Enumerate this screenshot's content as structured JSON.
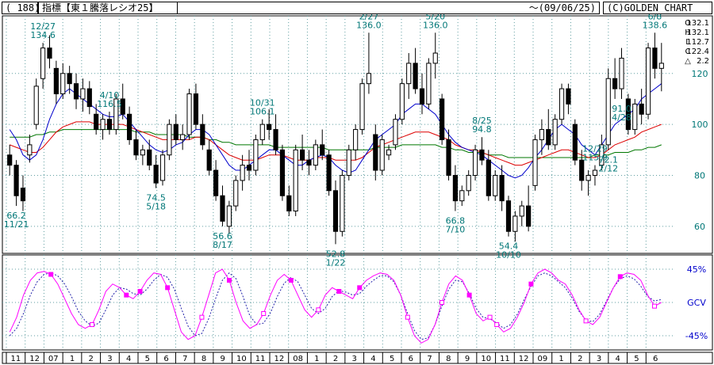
{
  "header": {
    "code": "( 188)",
    "title": "指標【東１騰落レシオ25】",
    "date_range": "～(09/06/25)",
    "brand": "(C)GOLDEN CHART"
  },
  "ohlc": {
    "o_label": "O",
    "o_value": "132.1",
    "h_label": "H",
    "h_value": "132.1",
    "l_label": "L",
    "l_value": "112.7",
    "c_label": "C",
    "c_value": "122.4",
    "d_label": "△",
    "d_value": "2.2"
  },
  "colors": {
    "up_candle": "#ffffff",
    "down_candle": "#000000",
    "ma_short": "#0000cc",
    "ma_mid": "#dd0000",
    "ma_long": "#007700",
    "oscillator": "#ff00ff",
    "oscillator_signal": "#2222aa",
    "annotation": "#007777",
    "grid": "#5f9ea0",
    "oscillator_axis": "#0000cc"
  },
  "chart_data": [
    {
      "type": "candlestick",
      "title": "指標【東１騰落レシオ25】",
      "x_range": [
        "2006-11",
        "2009-06"
      ],
      "ylim": [
        50,
        142
      ],
      "yticks": [
        60,
        80,
        100,
        120
      ],
      "grid": true,
      "legend": "none",
      "x_ticks": [
        "11",
        "12",
        "07",
        "1",
        "2",
        "3",
        "4",
        "5",
        "6",
        "7",
        "8",
        "9",
        "10",
        "11",
        "12",
        "08",
        "1",
        "2",
        "3",
        "4",
        "5",
        "6",
        "7",
        "8",
        "9",
        "10",
        "11",
        "12",
        "09",
        "1",
        "2",
        "3",
        "4",
        "5",
        "6"
      ],
      "annotations": [
        {
          "date": "11/21",
          "value": "66.2",
          "kind": "low"
        },
        {
          "date": "12/27",
          "value": "134.6",
          "kind": "high"
        },
        {
          "date": "4/10",
          "value": "116.5",
          "kind": "high"
        },
        {
          "date": "5/18",
          "value": "74.5",
          "kind": "low"
        },
        {
          "date": "8/17",
          "value": "56.6",
          "kind": "low"
        },
        {
          "date": "10/31",
          "value": "106.1",
          "kind": "high"
        },
        {
          "date": "1/22",
          "value": "52.8",
          "kind": "low"
        },
        {
          "date": "2/27",
          "value": "136.0",
          "kind": "high"
        },
        {
          "date": "5/20",
          "value": "136.0",
          "kind": "high"
        },
        {
          "date": "7/10",
          "value": "66.8",
          "kind": "low"
        },
        {
          "date": "8/25",
          "value": "94.8",
          "kind": "high"
        },
        {
          "date": "10/10",
          "value": "54.4",
          "kind": "low"
        },
        {
          "date": "12/29",
          "value": "115.9",
          "kind": "high"
        },
        {
          "date": "2/12",
          "value": "72.1",
          "kind": "low"
        },
        {
          "date": "4/28",
          "value": "91.0",
          "kind": "low"
        },
        {
          "date": "6/8",
          "value": "138.6",
          "kind": "high"
        }
      ],
      "candles": [
        {
          "o": 88,
          "h": 92,
          "l": 80,
          "c": 84
        },
        {
          "o": 84,
          "h": 86,
          "l": 68,
          "c": 72
        },
        {
          "o": 75,
          "h": 80,
          "l": 66,
          "c": 70
        },
        {
          "o": 88,
          "h": 96,
          "l": 85,
          "c": 92
        },
        {
          "o": 100,
          "h": 118,
          "l": 98,
          "c": 115
        },
        {
          "o": 118,
          "h": 132,
          "l": 114,
          "c": 130
        },
        {
          "o": 130,
          "h": 135,
          "l": 122,
          "c": 126
        },
        {
          "o": 122,
          "h": 125,
          "l": 108,
          "c": 112
        },
        {
          "o": 112,
          "h": 124,
          "l": 110,
          "c": 120
        },
        {
          "o": 120,
          "h": 123,
          "l": 112,
          "c": 116
        },
        {
          "o": 116,
          "h": 120,
          "l": 106,
          "c": 110
        },
        {
          "o": 110,
          "h": 118,
          "l": 105,
          "c": 114
        },
        {
          "o": 114,
          "h": 117,
          "l": 104,
          "c": 107
        },
        {
          "o": 104,
          "h": 108,
          "l": 96,
          "c": 98
        },
        {
          "o": 98,
          "h": 104,
          "l": 94,
          "c": 102
        },
        {
          "o": 102,
          "h": 105,
          "l": 96,
          "c": 98
        },
        {
          "o": 98,
          "h": 112,
          "l": 96,
          "c": 110
        },
        {
          "o": 110,
          "h": 116,
          "l": 102,
          "c": 104
        },
        {
          "o": 104,
          "h": 107,
          "l": 92,
          "c": 94
        },
        {
          "o": 94,
          "h": 98,
          "l": 86,
          "c": 88
        },
        {
          "o": 88,
          "h": 92,
          "l": 84,
          "c": 90
        },
        {
          "o": 90,
          "h": 94,
          "l": 82,
          "c": 84
        },
        {
          "o": 84,
          "h": 88,
          "l": 75,
          "c": 77
        },
        {
          "o": 78,
          "h": 90,
          "l": 76,
          "c": 88
        },
        {
          "o": 88,
          "h": 102,
          "l": 86,
          "c": 100
        },
        {
          "o": 100,
          "h": 104,
          "l": 92,
          "c": 94
        },
        {
          "o": 94,
          "h": 100,
          "l": 90,
          "c": 96
        },
        {
          "o": 96,
          "h": 114,
          "l": 94,
          "c": 112
        },
        {
          "o": 112,
          "h": 116,
          "l": 98,
          "c": 100
        },
        {
          "o": 100,
          "h": 104,
          "l": 90,
          "c": 92
        },
        {
          "o": 90,
          "h": 94,
          "l": 80,
          "c": 82
        },
        {
          "o": 82,
          "h": 86,
          "l": 70,
          "c": 72
        },
        {
          "o": 72,
          "h": 76,
          "l": 60,
          "c": 62
        },
        {
          "o": 60,
          "h": 70,
          "l": 57,
          "c": 68
        },
        {
          "o": 68,
          "h": 80,
          "l": 66,
          "c": 78
        },
        {
          "o": 78,
          "h": 88,
          "l": 74,
          "c": 84
        },
        {
          "o": 84,
          "h": 90,
          "l": 78,
          "c": 82
        },
        {
          "o": 82,
          "h": 96,
          "l": 80,
          "c": 94
        },
        {
          "o": 94,
          "h": 102,
          "l": 92,
          "c": 100
        },
        {
          "o": 100,
          "h": 106,
          "l": 94,
          "c": 98
        },
        {
          "o": 98,
          "h": 104,
          "l": 88,
          "c": 90
        },
        {
          "o": 90,
          "h": 92,
          "l": 70,
          "c": 72
        },
        {
          "o": 72,
          "h": 76,
          "l": 64,
          "c": 66
        },
        {
          "o": 66,
          "h": 92,
          "l": 64,
          "c": 90
        },
        {
          "o": 90,
          "h": 96,
          "l": 82,
          "c": 86
        },
        {
          "o": 86,
          "h": 90,
          "l": 80,
          "c": 84
        },
        {
          "o": 84,
          "h": 94,
          "l": 82,
          "c": 92
        },
        {
          "o": 92,
          "h": 98,
          "l": 86,
          "c": 88
        },
        {
          "o": 88,
          "h": 90,
          "l": 72,
          "c": 74
        },
        {
          "o": 74,
          "h": 78,
          "l": 53,
          "c": 58
        },
        {
          "o": 58,
          "h": 82,
          "l": 56,
          "c": 80
        },
        {
          "o": 80,
          "h": 92,
          "l": 78,
          "c": 90
        },
        {
          "o": 90,
          "h": 100,
          "l": 86,
          "c": 98
        },
        {
          "o": 98,
          "h": 118,
          "l": 96,
          "c": 116
        },
        {
          "o": 116,
          "h": 136,
          "l": 112,
          "c": 120
        },
        {
          "o": 96,
          "h": 100,
          "l": 78,
          "c": 82
        },
        {
          "o": 82,
          "h": 96,
          "l": 80,
          "c": 94
        },
        {
          "o": 88,
          "h": 92,
          "l": 86,
          "c": 90
        },
        {
          "o": 92,
          "h": 104,
          "l": 90,
          "c": 102
        },
        {
          "o": 102,
          "h": 118,
          "l": 100,
          "c": 116
        },
        {
          "o": 116,
          "h": 128,
          "l": 110,
          "c": 124
        },
        {
          "o": 124,
          "h": 130,
          "l": 112,
          "c": 114
        },
        {
          "o": 114,
          "h": 120,
          "l": 104,
          "c": 108
        },
        {
          "o": 108,
          "h": 126,
          "l": 106,
          "c": 124
        },
        {
          "o": 124,
          "h": 136,
          "l": 118,
          "c": 128
        },
        {
          "o": 110,
          "h": 112,
          "l": 92,
          "c": 94
        },
        {
          "o": 94,
          "h": 98,
          "l": 78,
          "c": 80
        },
        {
          "o": 80,
          "h": 84,
          "l": 66,
          "c": 70
        },
        {
          "o": 70,
          "h": 76,
          "l": 68,
          "c": 74
        },
        {
          "o": 74,
          "h": 82,
          "l": 72,
          "c": 80
        },
        {
          "o": 80,
          "h": 92,
          "l": 78,
          "c": 90
        },
        {
          "o": 90,
          "h": 95,
          "l": 84,
          "c": 86
        },
        {
          "o": 86,
          "h": 90,
          "l": 70,
          "c": 72
        },
        {
          "o": 72,
          "h": 82,
          "l": 70,
          "c": 80
        },
        {
          "o": 80,
          "h": 84,
          "l": 66,
          "c": 70
        },
        {
          "o": 70,
          "h": 72,
          "l": 56,
          "c": 58
        },
        {
          "o": 58,
          "h": 66,
          "l": 54,
          "c": 64
        },
        {
          "o": 64,
          "h": 70,
          "l": 60,
          "c": 68
        },
        {
          "o": 68,
          "h": 76,
          "l": 58,
          "c": 60
        },
        {
          "o": 76,
          "h": 96,
          "l": 74,
          "c": 94
        },
        {
          "o": 94,
          "h": 102,
          "l": 88,
          "c": 98
        },
        {
          "o": 98,
          "h": 106,
          "l": 90,
          "c": 92
        },
        {
          "o": 92,
          "h": 104,
          "l": 90,
          "c": 102
        },
        {
          "o": 102,
          "h": 116,
          "l": 100,
          "c": 114
        },
        {
          "o": 114,
          "h": 116,
          "l": 104,
          "c": 108
        },
        {
          "o": 100,
          "h": 102,
          "l": 84,
          "c": 86
        },
        {
          "o": 86,
          "h": 90,
          "l": 74,
          "c": 78
        },
        {
          "o": 78,
          "h": 82,
          "l": 72,
          "c": 80
        },
        {
          "o": 80,
          "h": 84,
          "l": 76,
          "c": 82
        },
        {
          "o": 84,
          "h": 96,
          "l": 82,
          "c": 92
        },
        {
          "o": 92,
          "h": 122,
          "l": 90,
          "c": 118
        },
        {
          "o": 118,
          "h": 126,
          "l": 110,
          "c": 114
        },
        {
          "o": 114,
          "h": 130,
          "l": 110,
          "c": 126
        },
        {
          "o": 110,
          "h": 112,
          "l": 96,
          "c": 98
        },
        {
          "o": 98,
          "h": 110,
          "l": 96,
          "c": 108
        },
        {
          "o": 108,
          "h": 114,
          "l": 100,
          "c": 104
        },
        {
          "o": 104,
          "h": 132,
          "l": 102,
          "c": 130
        },
        {
          "o": 130,
          "h": 136,
          "l": 118,
          "c": 122
        },
        {
          "o": 122,
          "h": 132,
          "l": 113,
          "c": 124
        }
      ],
      "ma_short_values": [
        98,
        94,
        88,
        86,
        88,
        94,
        102,
        108,
        112,
        114,
        112,
        110,
        108,
        106,
        104,
        103,
        103,
        104,
        101,
        98,
        95,
        92,
        90,
        89,
        90,
        92,
        93,
        96,
        98,
        98,
        96,
        92,
        88,
        84,
        82,
        82,
        84,
        86,
        88,
        90,
        90,
        88,
        86,
        84,
        84,
        86,
        87,
        88,
        87,
        84,
        82,
        81,
        82,
        86,
        90,
        94,
        96,
        98,
        100,
        104,
        106,
        108,
        108,
        106,
        104,
        100,
        96,
        93,
        91,
        90,
        89,
        88,
        86,
        84,
        82,
        80,
        79,
        80,
        83,
        87,
        90,
        94,
        98,
        100,
        98,
        96,
        92,
        90,
        88,
        92,
        96,
        100,
        102,
        104,
        106,
        110,
        112,
        114,
        116
      ],
      "ma_mid_values": [
        92,
        91,
        90,
        89,
        89,
        91,
        94,
        97,
        99,
        100,
        101,
        101,
        101,
        100,
        100,
        100,
        100,
        100,
        99,
        98,
        97,
        96,
        95,
        94,
        94,
        94,
        94,
        94,
        95,
        95,
        94,
        92,
        90,
        88,
        87,
        86,
        86,
        86,
        87,
        88,
        88,
        88,
        87,
        86,
        86,
        86,
        87,
        87,
        87,
        86,
        86,
        86,
        86,
        87,
        89,
        91,
        92,
        93,
        94,
        95,
        96,
        97,
        97,
        97,
        96,
        95,
        94,
        92,
        91,
        90,
        90,
        89,
        88,
        87,
        86,
        85,
        84,
        84,
        85,
        86,
        87,
        88,
        89,
        90,
        90,
        89,
        88,
        87,
        87,
        88,
        90,
        92,
        93,
        94,
        95,
        97,
        98,
        99,
        100
      ],
      "ma_long_values": [
        95,
        95,
        95,
        95,
        96,
        96,
        97,
        97,
        98,
        98,
        98,
        98,
        98,
        98,
        98,
        98,
        98,
        98,
        98,
        97,
        97,
        97,
        96,
        96,
        96,
        96,
        96,
        95,
        95,
        95,
        94,
        94,
        93,
        93,
        92,
        92,
        92,
        92,
        92,
        92,
        91,
        91,
        91,
        91,
        91,
        91,
        91,
        91,
        90,
        90,
        90,
        90,
        90,
        90,
        90,
        91,
        91,
        91,
        91,
        92,
        92,
        92,
        92,
        92,
        92,
        91,
        91,
        90,
        90,
        89,
        89,
        89,
        88,
        88,
        88,
        87,
        87,
        87,
        87,
        87,
        87,
        87,
        87,
        87,
        87,
        87,
        87,
        87,
        88,
        88,
        88,
        89,
        89,
        89,
        90,
        90,
        91,
        91,
        92
      ]
    },
    {
      "type": "line",
      "title": "",
      "yticks": [
        "45%",
        "GCV",
        "-45%"
      ],
      "ylim": [
        -60,
        60
      ],
      "grid": true,
      "series": [
        {
          "values": [
            -40,
            -20,
            10,
            30,
            40,
            42,
            38,
            25,
            5,
            -15,
            -30,
            -35,
            -30,
            -10,
            15,
            25,
            20,
            10,
            5,
            15,
            30,
            40,
            38,
            20,
            -10,
            -40,
            -50,
            -45,
            -20,
            10,
            40,
            45,
            30,
            0,
            -25,
            -35,
            -30,
            -15,
            10,
            30,
            38,
            30,
            10,
            -10,
            -20,
            -10,
            10,
            20,
            15,
            10,
            5,
            20,
            30,
            36,
            40,
            38,
            30,
            10,
            -20,
            -45,
            -55,
            -50,
            -30,
            0,
            25,
            36,
            30,
            10,
            -15,
            -25,
            -20,
            -30,
            -40,
            -35,
            -20,
            0,
            25,
            40,
            45,
            40,
            30,
            25,
            10,
            -10,
            -25,
            -30,
            -20,
            0,
            20,
            35,
            40,
            38,
            30,
            10,
            -5,
            0
          ]
        },
        {
          "values": [
            -45,
            -35,
            -15,
            10,
            28,
            38,
            40,
            36,
            25,
            8,
            -12,
            -25,
            -32,
            -28,
            -10,
            10,
            20,
            18,
            12,
            10,
            18,
            30,
            38,
            34,
            18,
            -8,
            -32,
            -45,
            -42,
            -22,
            5,
            30,
            40,
            32,
            8,
            -18,
            -30,
            -28,
            -14,
            8,
            26,
            34,
            28,
            10,
            -8,
            -15,
            -8,
            8,
            16,
            14,
            10,
            12,
            22,
            30,
            36,
            36,
            28,
            10,
            -15,
            -38,
            -50,
            -48,
            -30,
            -5,
            18,
            30,
            28,
            12,
            -8,
            -20,
            -22,
            -28,
            -35,
            -30,
            -16,
            4,
            22,
            36,
            40,
            36,
            28,
            20,
            6,
            -12,
            -24,
            -26,
            -16,
            2,
            20,
            32,
            36,
            32,
            22,
            8,
            2,
            4
          ]
        }
      ]
    }
  ]
}
